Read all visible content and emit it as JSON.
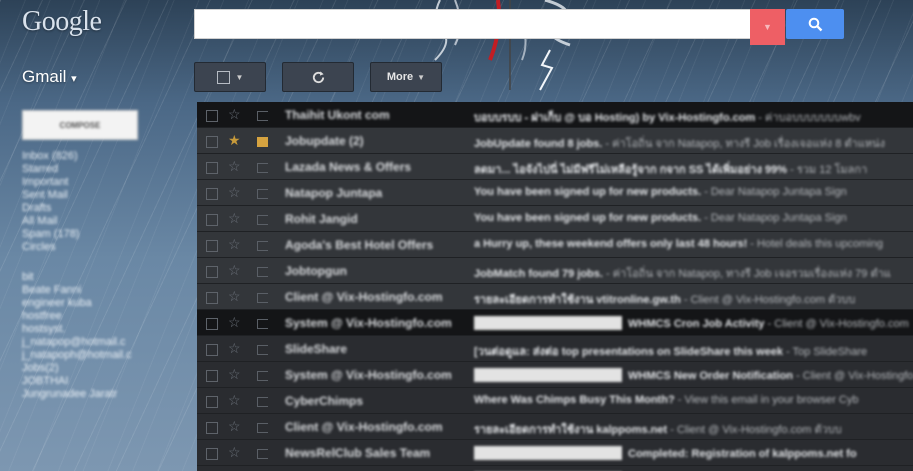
{
  "header": {
    "logo": "Google",
    "search": {
      "value": "",
      "placeholder": ""
    }
  },
  "app": {
    "label": "Gmail",
    "caret": "▾"
  },
  "toolbar": {
    "more_label": "More"
  },
  "sidebar": {
    "compose_label": "COMPOSE",
    "items": [
      "Inbox (826)",
      "Starred",
      "Important",
      "Sent Mail",
      "Drafts",
      "All Mail",
      "Spam (178)",
      "Circles"
    ],
    "labels": [
      "bit",
      "Beate Fanni",
      "engineer kuba",
      "hostfree",
      "hostsyst.",
      "j_natapop@hotmail.c",
      "j_natapoph@hotmail.c",
      "Jobs(2)",
      "JOBTHAI",
      "Jungrunadee Jaratr"
    ]
  },
  "emails": [
    {
      "sender": "Thaihit Ukont com",
      "subject": "บอบบรบบ - ฝาเก็บ @ บอ Hosting) by Vix-Hostingfo.com",
      "snippet": " - ค่าบอบบบบบบบwbv",
      "tag": false,
      "star": false,
      "imp": false,
      "style": "dark"
    },
    {
      "sender": "Jobupdate (2)",
      "subject": "JobUpdate found 8 jobs.",
      "snippet": " - ค่าโอถิ่น จาก Natapop, ทางรี Job เรื่องเจอแห่ง 8 ตำแหน่ง",
      "tag": false,
      "star": true,
      "imp": true,
      "style": "unread"
    },
    {
      "sender": "Lazada News & Offers",
      "subject": "ลดมา... ไอจังไปนี่ ไม่มีฟรีไม่เหลือรู้จาก กจาก SS ได้เพิ่มอย่าง 99%",
      "snippet": " - รวม 12 โมลกา",
      "tag": false,
      "star": false,
      "imp": false,
      "style": "unread"
    },
    {
      "sender": "Natapop Juntapa",
      "subject": "You have been signed up for new products.",
      "snippet": " - Dear Natapop Juntapa Sign",
      "tag": false,
      "star": false,
      "imp": false,
      "style": "unread"
    },
    {
      "sender": "Rohit Jangid",
      "subject": "You have been signed up for new products.",
      "snippet": " - Dear Natapop Juntapa Sign",
      "tag": false,
      "star": false,
      "imp": false,
      "style": "unread"
    },
    {
      "sender": "Agoda's Best Hotel Offers",
      "subject": "a Hurry up, these weekend offers only last 48 hours!",
      "snippet": " - Hotel deals this upcoming",
      "tag": false,
      "star": false,
      "imp": false,
      "style": "unread"
    },
    {
      "sender": "Jobtopgun",
      "subject": "JobMatch found 79 jobs.",
      "snippet": " - ค่าโอถิ่น จาก Natapop, ทางรี Job เจอรวมเรื่องแห่ง 79 ตำแ",
      "tag": false,
      "star": false,
      "imp": false,
      "style": "unread"
    },
    {
      "sender": "Client @ Vix-Hostingfo.com",
      "subject": "รายละเอียดการทำใช้งาน vtitronline.gw.th",
      "snippet": " - Client @ Vix-Hostingfo.com ตัวบบ",
      "tag": false,
      "star": false,
      "imp": false,
      "style": "unread"
    },
    {
      "sender": "System @ Vix-Hostingfo.com",
      "subject": "WHMCS Cron Job Activity",
      "snippet": " - Client @ Vix-Hostingfo.com",
      "tag": true,
      "star": false,
      "imp": false,
      "style": "dark"
    },
    {
      "sender": "SlideShare",
      "subject": "[วนต่อดูแล: ส่งต่อ top presentations on SlideShare this week",
      "snippet": " - Top SlideShare",
      "tag": false,
      "star": false,
      "imp": false,
      "style": "read"
    },
    {
      "sender": "System @ Vix-Hostingfo.com",
      "subject": "WHMCS New Order Notification",
      "snippet": " - Client @ Vix-Hostingfo.com",
      "tag": true,
      "star": false,
      "imp": false,
      "style": "read"
    },
    {
      "sender": "CyberChimps",
      "subject": "Where Was Chimps Busy This Month?",
      "snippet": " - View this email in your browser Cyb",
      "tag": false,
      "star": false,
      "imp": false,
      "style": "read"
    },
    {
      "sender": "Client @ Vix-Hostingfo.com",
      "subject": "รายละเอียดการทำใช้งาน kalppoms.net",
      "snippet": " - Client @ Vix-Hostingfo.com ตัวบบ",
      "tag": false,
      "star": false,
      "imp": false,
      "style": "read"
    },
    {
      "sender": "NewsRelClub Sales Team",
      "subject": "Completed: Registration of kalppoms.net fo",
      "snippet": "",
      "tag": true,
      "star": false,
      "imp": false,
      "style": "read"
    },
    {
      "sender": "",
      "subject": "",
      "snippet": "",
      "tag": true,
      "star": false,
      "imp": false,
      "style": "read"
    }
  ],
  "colors": {
    "search_button": "#4d8ff0",
    "search_dropdown": "#ee5f65",
    "list_bg": "#2b2d31",
    "star_on": "#c79a3a"
  },
  "icons": [
    "search-icon",
    "refresh-icon",
    "checkbox-icon",
    "star-icon",
    "important-icon",
    "chevron-down-icon"
  ]
}
